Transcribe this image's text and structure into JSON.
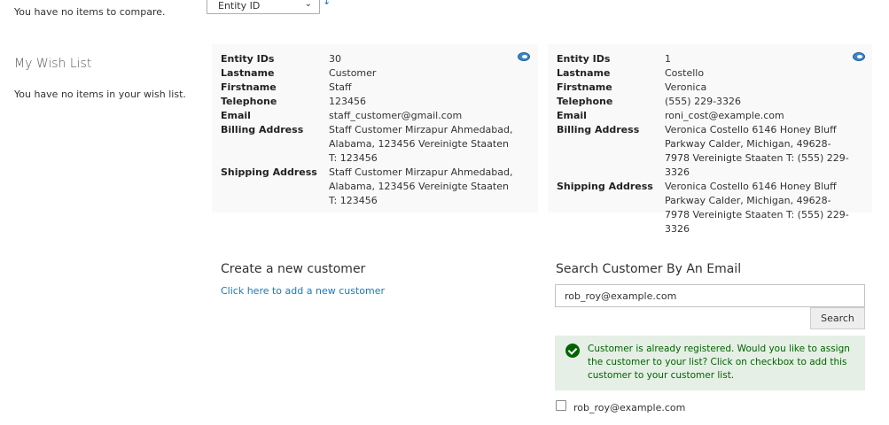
{
  "sidebar": {
    "compare_empty": "You have no items to compare.",
    "wishlist_title": "My Wish List",
    "wishlist_empty": "You have no items in your wish list."
  },
  "sort": {
    "selected": "Entity ID",
    "direction_icon": "arrow-down-icon"
  },
  "customers": [
    {
      "fields": [
        {
          "label": "Entity IDs",
          "value": "30"
        },
        {
          "label": "Lastname",
          "value": "Customer"
        },
        {
          "label": "Firstname",
          "value": "Staff"
        },
        {
          "label": "Telephone",
          "value": "123456"
        },
        {
          "label": "Email",
          "value": "staff_customer@gmail.com"
        },
        {
          "label": "Billing Address",
          "value": "Staff Customer Mirzapur Ahmedabad, Alabama, 123456 Vereinigte Staaten T: 123456"
        },
        {
          "label": "Shipping Address",
          "value": "Staff Customer Mirzapur Ahmedabad, Alabama, 123456 Vereinigte Staaten T: 123456"
        }
      ]
    },
    {
      "fields": [
        {
          "label": "Entity IDs",
          "value": "1"
        },
        {
          "label": "Lastname",
          "value": "Costello"
        },
        {
          "label": "Firstname",
          "value": "Veronica"
        },
        {
          "label": "Telephone",
          "value": "(555) 229-3326"
        },
        {
          "label": "Email",
          "value": "roni_cost@example.com"
        },
        {
          "label": "Billing Address",
          "value": "Veronica Costello 6146 Honey Bluff Parkway Calder, Michigan, 49628-7978 Vereinigte Staaten T: (555) 229-3326"
        },
        {
          "label": "Shipping Address",
          "value": "Veronica Costello 6146 Honey Bluff Parkway Calder, Michigan, 49628-7978 Vereinigte Staaten T: (555) 229-3326"
        }
      ]
    }
  ],
  "create": {
    "title": "Create a new customer",
    "link": "Click here to add a new customer"
  },
  "search": {
    "title": "Search Customer By An Email",
    "value": "rob_roy@example.com",
    "button": "Search",
    "message": "Customer is already registered. Would you like to assign the customer to your list? Click on checkbox to add this customer to your customer list.",
    "result_email": "rob_roy@example.com"
  },
  "colors": {
    "link": "#1979c3",
    "success_bg": "#e5efe5",
    "success_text": "#006400",
    "card_bg": "#f9f9f9"
  }
}
